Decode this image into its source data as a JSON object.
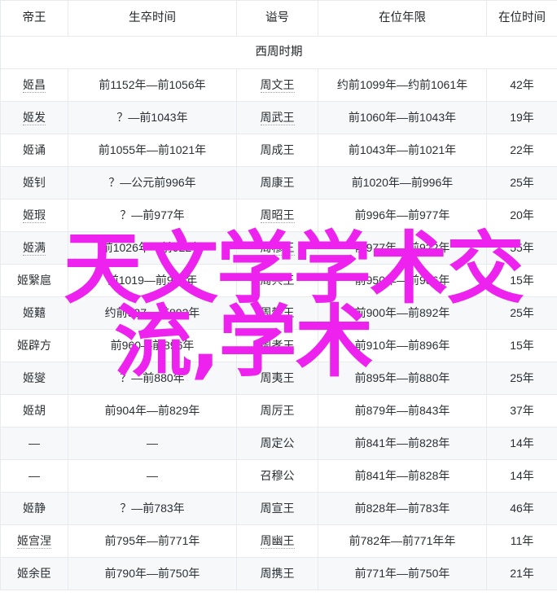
{
  "table": {
    "columns": [
      "帝王",
      "生卒时间",
      "谥号",
      "在位年限",
      "在位时间"
    ],
    "section_label": "西周时期",
    "rows": [
      {
        "name": "姬昌",
        "life": "前1152年—前1056年",
        "posthumous": "周文王",
        "reign_years": "约前1099年—约前1061年",
        "duration": "42年"
      },
      {
        "name": "姬发",
        "life": "？—前1043年",
        "posthumous": "周武王",
        "reign_years": "前1060年—前1043年",
        "duration": "19年"
      },
      {
        "name": "姬诵",
        "life": "前1055年—前1021年",
        "posthumous": "周成王",
        "reign_years": "前1043年—前1021年",
        "duration": "22年"
      },
      {
        "name": "姬钊",
        "life": "？—公元前996年",
        "posthumous": "周康王",
        "reign_years": "前1020年—前996年",
        "duration": "25年"
      },
      {
        "name": "姬瑕",
        "life": "？—前977年",
        "posthumous": "周昭王",
        "reign_years": "前996年—前977年",
        "duration": "20年"
      },
      {
        "name": "姬满",
        "life": "前1026年—前922年",
        "posthumous": "周穆王",
        "reign_years": "前977年—前922年",
        "duration": "55年"
      },
      {
        "name": "姬繄扈",
        "life": "前1019—前936年",
        "posthumous": "周共王",
        "reign_years": "前950年—前936年",
        "duration": "15年"
      },
      {
        "name": "姬囏",
        "life": "约前927—前892年",
        "posthumous": "周懿王",
        "reign_years": "前900年—前892年",
        "duration": "25年"
      },
      {
        "name": "姬辟方",
        "life": "前960—前896年",
        "posthumous": "周孝王",
        "reign_years": "前910年—前896年",
        "duration": "15年"
      },
      {
        "name": "姬燮",
        "life": "？—前880年",
        "posthumous": "周夷王",
        "reign_years": "前895年—前880年",
        "duration": "25年"
      },
      {
        "name": "姬胡",
        "life": "前904年—前829年",
        "posthumous": "周厉王",
        "reign_years": "前879年—前843年",
        "duration": "37年"
      },
      {
        "name": "—",
        "life": "—",
        "posthumous": "周定公",
        "reign_years": "前841年—前828年",
        "duration": "14年"
      },
      {
        "name": "—",
        "life": "—",
        "posthumous": "召穆公",
        "reign_years": "前841年—前828年",
        "duration": "14年"
      },
      {
        "name": "姬静",
        "life": "？—前783年",
        "posthumous": "周宣王",
        "reign_years": "前828年—前783年",
        "duration": "46年"
      },
      {
        "name": "姬宫涅",
        "life": "前795年—前771年",
        "posthumous": "周幽王",
        "reign_years": "前782年—前771年年",
        "duration": "11年"
      },
      {
        "name": "姬余臣",
        "life": "前790年—前750年",
        "posthumous": "周携王",
        "reign_years": "前771年—前750年",
        "duration": "21年"
      }
    ]
  },
  "watermark": {
    "line1": "天文学学术交",
    "line2": "流,学术",
    "color": "#ee22ee"
  }
}
